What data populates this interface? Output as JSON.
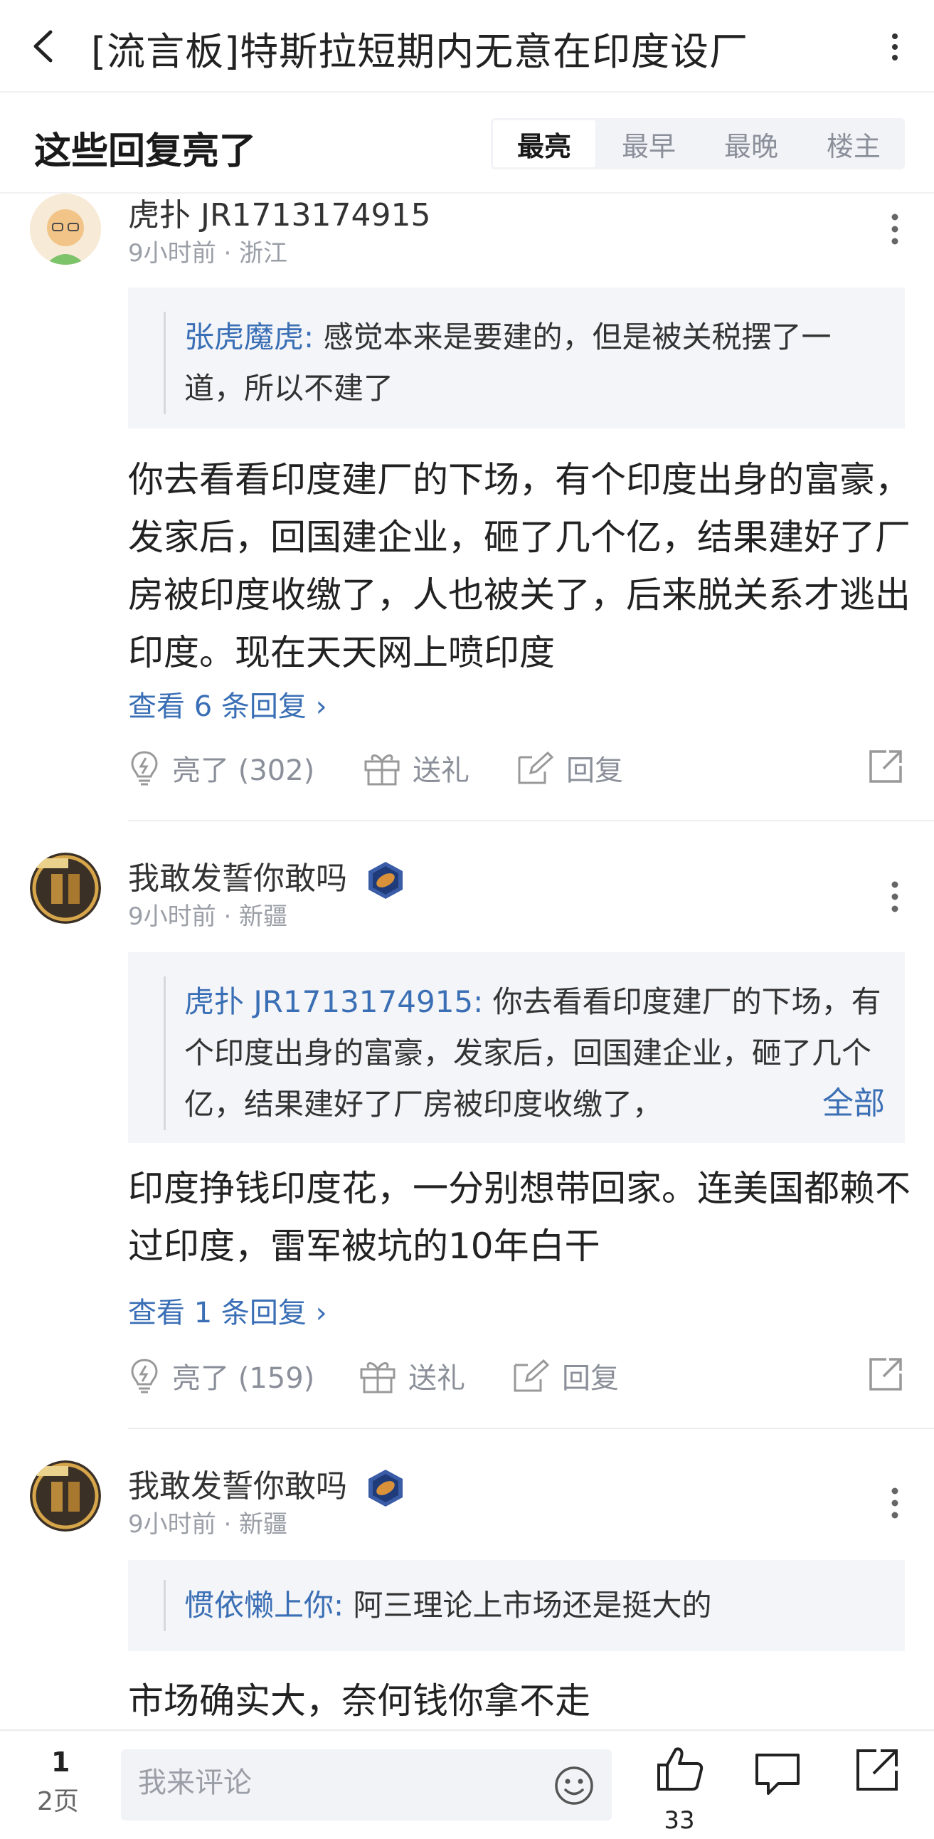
{
  "topbar": {
    "title": "[流言板]特斯拉短期内无意在印度设厂"
  },
  "sort": {
    "heading": "这些回复亮了",
    "tabs": [
      "最亮",
      "最早",
      "最晚",
      "楼主"
    ],
    "active": "最亮"
  },
  "comments": [
    {
      "username": "虎扑 JR1713174915",
      "meta": "9小时前 · 浙江",
      "quote_name": "张虎魔虎:",
      "quote_text": " 感觉本来是要建的，但是被关税摆了一道，所以不建了",
      "body": "你去看看印度建厂的下场，有个印度出身的富豪，发家后，回国建企业，砸了几个亿，结果建好了厂房被印度收缴了，人也被关了，后来脱关系才逃出印度。现在天天网上喷印度",
      "view_replies": "查看 6 条回复 ›",
      "like_label": "亮了 (302)",
      "gift_label": "送礼",
      "reply_label": "回复"
    },
    {
      "username": "我敢发誓你敢吗",
      "meta": "9小时前 · 新疆",
      "quote_name": "虎扑 JR1713174915:",
      "quote_text": " 你去看看印度建厂的下场，有个印度出身的富豪，发家后，回国建企业，砸了几个亿，结果建好了厂房被印度收缴了，",
      "quote_more": "全部",
      "body": "印度挣钱印度花，一分别想带回家。连美国都赖不过印度，雷军被坑的10年白干",
      "view_replies": "查看 1 条回复 ›",
      "like_label": "亮了 (159)",
      "gift_label": "送礼",
      "reply_label": "回复"
    },
    {
      "username": "我敢发誓你敢吗",
      "meta": "9小时前 · 新疆",
      "quote_name": "惯依懒上你:",
      "quote_text": " 阿三理论上市场还是挺大的",
      "body": "市场确实大，奈何钱你拿不走"
    }
  ],
  "bottom": {
    "page_current": "1",
    "page_total": "2页",
    "input_placeholder": "我来评论",
    "like_count": "33"
  },
  "colors": {
    "link_blue": "#3a6fb5",
    "muted_gray": "#8a8f99",
    "quote_bg": "#f4f5f8"
  }
}
